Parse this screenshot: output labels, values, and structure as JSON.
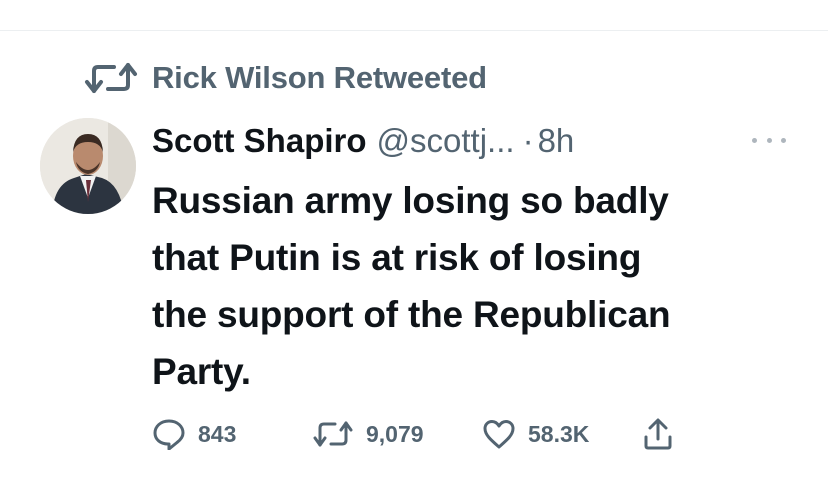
{
  "social_context": {
    "text": "Rick Wilson Retweeted",
    "icon": "retweet-icon"
  },
  "author": {
    "name": "Scott Shapiro",
    "handle": "@scottj...",
    "separator": "·",
    "time": "8h",
    "avatar_icon": "avatar"
  },
  "menu": {
    "icon": "more-icon"
  },
  "tweet": {
    "lines": [
      "Russian army losing so badly",
      "that Putin is at risk of losing",
      "the support of the Republican",
      "Party."
    ]
  },
  "actions": {
    "reply": {
      "icon": "reply-icon",
      "count": "843"
    },
    "retweet": {
      "icon": "retweet-icon",
      "count": "9,079"
    },
    "like": {
      "icon": "heart-icon",
      "count": "58.3K"
    },
    "share": {
      "icon": "share-icon"
    }
  },
  "colors": {
    "text": "#0f1419",
    "secondary": "#536471",
    "background": "#ffffff"
  }
}
